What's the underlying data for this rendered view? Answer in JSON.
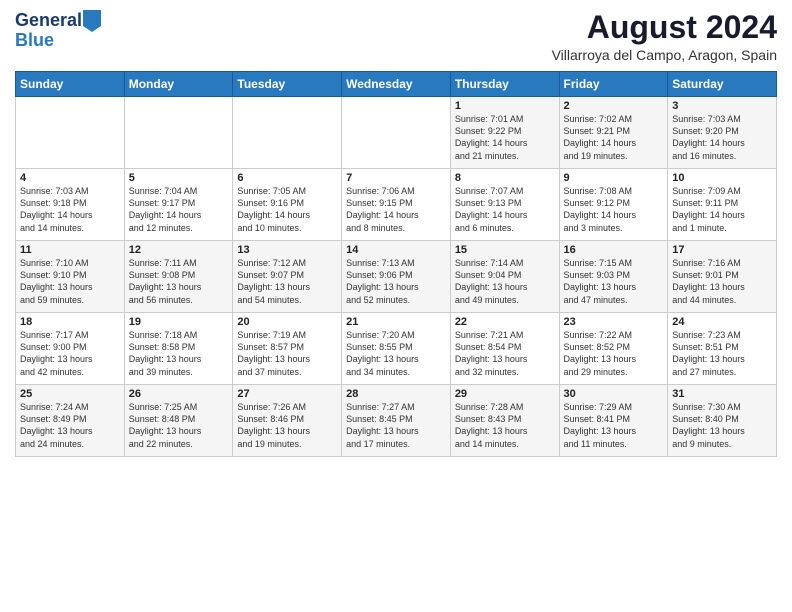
{
  "header": {
    "logo_line1": "General",
    "logo_line2": "Blue",
    "main_title": "August 2024",
    "subtitle": "Villarroya del Campo, Aragon, Spain"
  },
  "weekdays": [
    "Sunday",
    "Monday",
    "Tuesday",
    "Wednesday",
    "Thursday",
    "Friday",
    "Saturday"
  ],
  "weeks": [
    [
      {
        "day": "",
        "info": ""
      },
      {
        "day": "",
        "info": ""
      },
      {
        "day": "",
        "info": ""
      },
      {
        "day": "",
        "info": ""
      },
      {
        "day": "1",
        "info": "Sunrise: 7:01 AM\nSunset: 9:22 PM\nDaylight: 14 hours\nand 21 minutes."
      },
      {
        "day": "2",
        "info": "Sunrise: 7:02 AM\nSunset: 9:21 PM\nDaylight: 14 hours\nand 19 minutes."
      },
      {
        "day": "3",
        "info": "Sunrise: 7:03 AM\nSunset: 9:20 PM\nDaylight: 14 hours\nand 16 minutes."
      }
    ],
    [
      {
        "day": "4",
        "info": "Sunrise: 7:03 AM\nSunset: 9:18 PM\nDaylight: 14 hours\nand 14 minutes."
      },
      {
        "day": "5",
        "info": "Sunrise: 7:04 AM\nSunset: 9:17 PM\nDaylight: 14 hours\nand 12 minutes."
      },
      {
        "day": "6",
        "info": "Sunrise: 7:05 AM\nSunset: 9:16 PM\nDaylight: 14 hours\nand 10 minutes."
      },
      {
        "day": "7",
        "info": "Sunrise: 7:06 AM\nSunset: 9:15 PM\nDaylight: 14 hours\nand 8 minutes."
      },
      {
        "day": "8",
        "info": "Sunrise: 7:07 AM\nSunset: 9:13 PM\nDaylight: 14 hours\nand 6 minutes."
      },
      {
        "day": "9",
        "info": "Sunrise: 7:08 AM\nSunset: 9:12 PM\nDaylight: 14 hours\nand 3 minutes."
      },
      {
        "day": "10",
        "info": "Sunrise: 7:09 AM\nSunset: 9:11 PM\nDaylight: 14 hours\nand 1 minute."
      }
    ],
    [
      {
        "day": "11",
        "info": "Sunrise: 7:10 AM\nSunset: 9:10 PM\nDaylight: 13 hours\nand 59 minutes."
      },
      {
        "day": "12",
        "info": "Sunrise: 7:11 AM\nSunset: 9:08 PM\nDaylight: 13 hours\nand 56 minutes."
      },
      {
        "day": "13",
        "info": "Sunrise: 7:12 AM\nSunset: 9:07 PM\nDaylight: 13 hours\nand 54 minutes."
      },
      {
        "day": "14",
        "info": "Sunrise: 7:13 AM\nSunset: 9:06 PM\nDaylight: 13 hours\nand 52 minutes."
      },
      {
        "day": "15",
        "info": "Sunrise: 7:14 AM\nSunset: 9:04 PM\nDaylight: 13 hours\nand 49 minutes."
      },
      {
        "day": "16",
        "info": "Sunrise: 7:15 AM\nSunset: 9:03 PM\nDaylight: 13 hours\nand 47 minutes."
      },
      {
        "day": "17",
        "info": "Sunrise: 7:16 AM\nSunset: 9:01 PM\nDaylight: 13 hours\nand 44 minutes."
      }
    ],
    [
      {
        "day": "18",
        "info": "Sunrise: 7:17 AM\nSunset: 9:00 PM\nDaylight: 13 hours\nand 42 minutes."
      },
      {
        "day": "19",
        "info": "Sunrise: 7:18 AM\nSunset: 8:58 PM\nDaylight: 13 hours\nand 39 minutes."
      },
      {
        "day": "20",
        "info": "Sunrise: 7:19 AM\nSunset: 8:57 PM\nDaylight: 13 hours\nand 37 minutes."
      },
      {
        "day": "21",
        "info": "Sunrise: 7:20 AM\nSunset: 8:55 PM\nDaylight: 13 hours\nand 34 minutes."
      },
      {
        "day": "22",
        "info": "Sunrise: 7:21 AM\nSunset: 8:54 PM\nDaylight: 13 hours\nand 32 minutes."
      },
      {
        "day": "23",
        "info": "Sunrise: 7:22 AM\nSunset: 8:52 PM\nDaylight: 13 hours\nand 29 minutes."
      },
      {
        "day": "24",
        "info": "Sunrise: 7:23 AM\nSunset: 8:51 PM\nDaylight: 13 hours\nand 27 minutes."
      }
    ],
    [
      {
        "day": "25",
        "info": "Sunrise: 7:24 AM\nSunset: 8:49 PM\nDaylight: 13 hours\nand 24 minutes."
      },
      {
        "day": "26",
        "info": "Sunrise: 7:25 AM\nSunset: 8:48 PM\nDaylight: 13 hours\nand 22 minutes."
      },
      {
        "day": "27",
        "info": "Sunrise: 7:26 AM\nSunset: 8:46 PM\nDaylight: 13 hours\nand 19 minutes."
      },
      {
        "day": "28",
        "info": "Sunrise: 7:27 AM\nSunset: 8:45 PM\nDaylight: 13 hours\nand 17 minutes."
      },
      {
        "day": "29",
        "info": "Sunrise: 7:28 AM\nSunset: 8:43 PM\nDaylight: 13 hours\nand 14 minutes."
      },
      {
        "day": "30",
        "info": "Sunrise: 7:29 AM\nSunset: 8:41 PM\nDaylight: 13 hours\nand 11 minutes."
      },
      {
        "day": "31",
        "info": "Sunrise: 7:30 AM\nSunset: 8:40 PM\nDaylight: 13 hours\nand 9 minutes."
      }
    ]
  ]
}
